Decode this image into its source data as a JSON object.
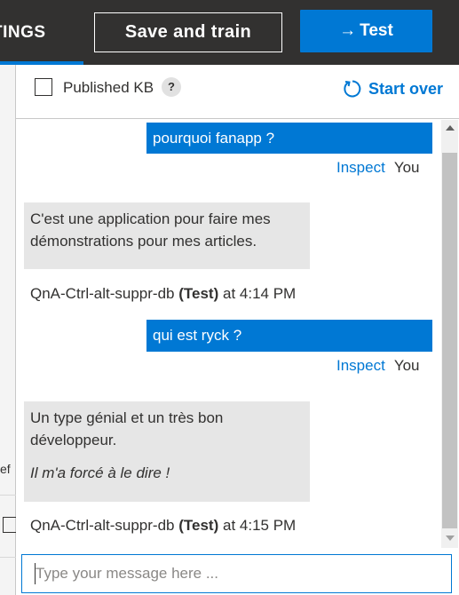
{
  "topbar": {
    "settings_tab_label": "TINGS",
    "save_train_label": "Save and train",
    "test_arrow": "→",
    "test_label": "Test"
  },
  "background_page": {
    "fragment_text": "ef"
  },
  "panel": {
    "published_kb_label": "Published KB",
    "help_badge": "?",
    "start_over_label": "Start over"
  },
  "conversation": [
    {
      "user_text": "pourquoi fanapp ?",
      "inspect_label": "Inspect",
      "you_label": "You",
      "bot_line1": "C'est une application pour faire mes démonstrations pour mes articles.",
      "bot_name": "QnA-Ctrl-alt-suppr-db",
      "bot_env": "(Test)",
      "bot_time": "at 4:14 PM"
    },
    {
      "user_text": "qui est ryck ?",
      "inspect_label": "Inspect",
      "you_label": "You",
      "bot_line1": "Un type génial et un très bon développeur.",
      "bot_line2": "Il m'a forcé à le dire !",
      "bot_name": "QnA-Ctrl-alt-suppr-db",
      "bot_env": "(Test)",
      "bot_time": "at 4:15 PM"
    }
  ],
  "input": {
    "placeholder": "Type your message here ..."
  },
  "colors": {
    "accent": "#0078d4",
    "topbar_bg": "#323130",
    "bot_bubble": "#e6e6e6"
  },
  "icons": {
    "start_over": "refresh-icon",
    "test_arrow": "arrow-right-icon"
  }
}
